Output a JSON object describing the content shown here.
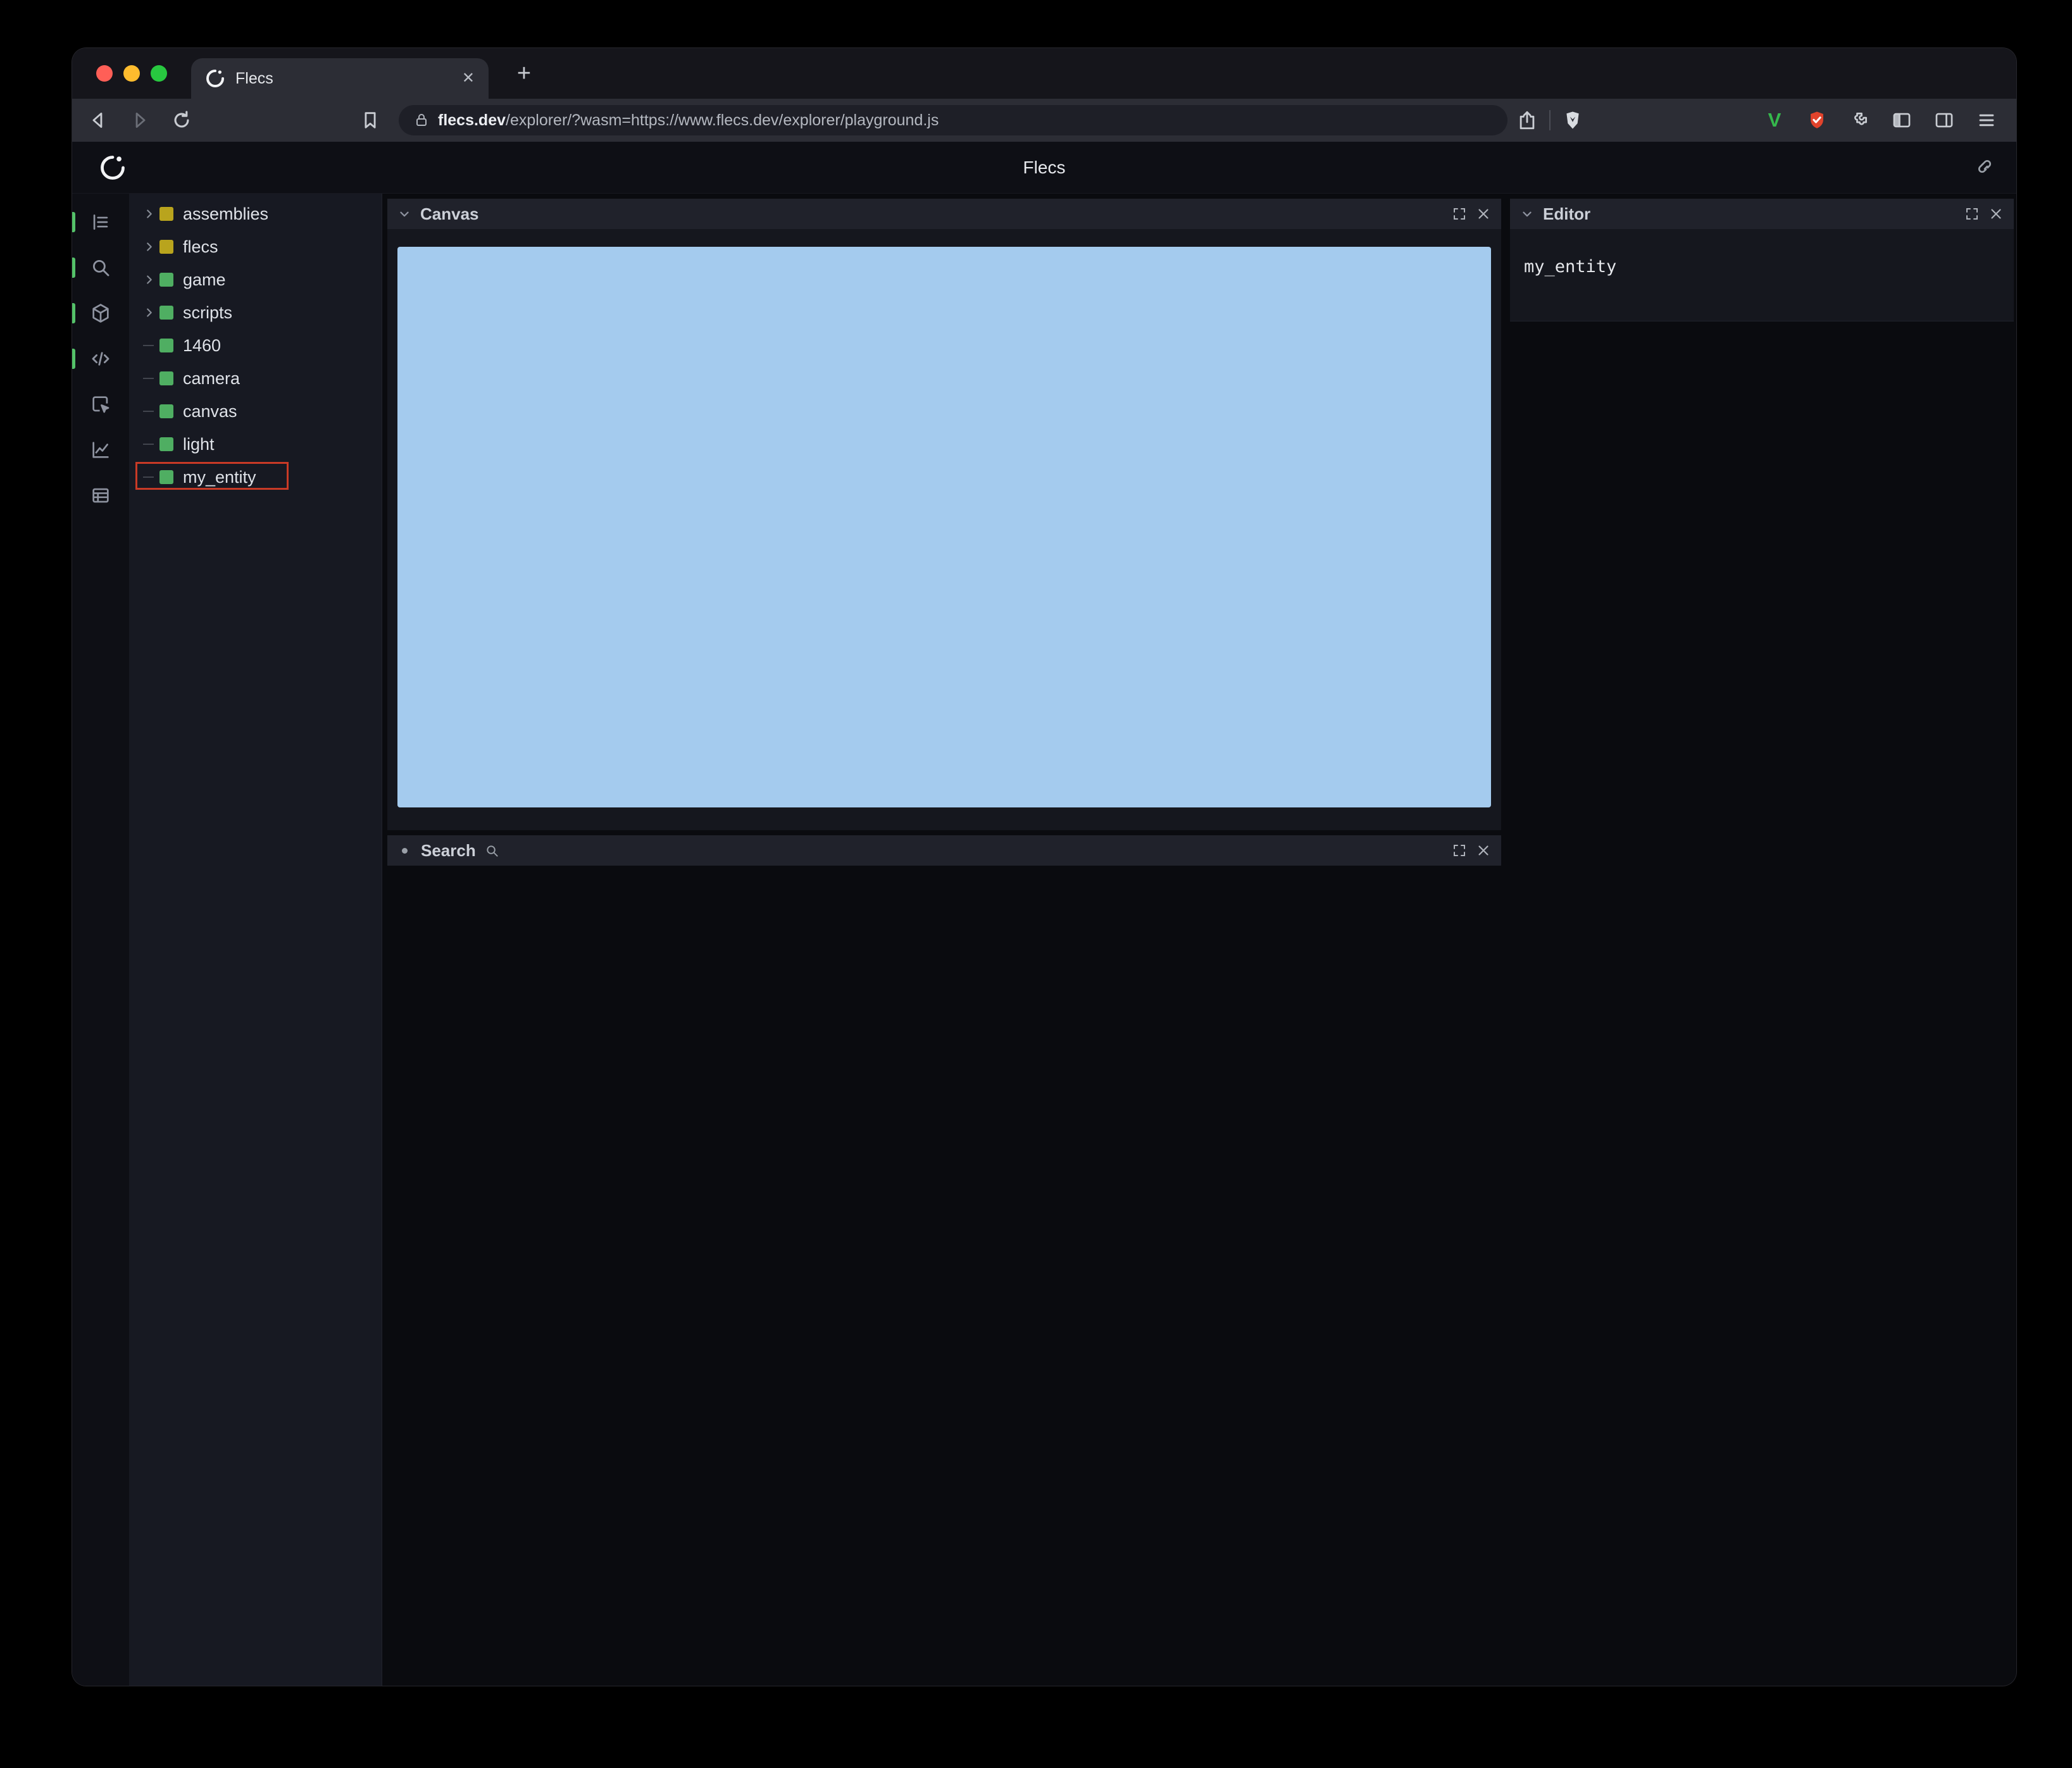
{
  "browser": {
    "tab": {
      "title": "Flecs"
    },
    "new_tab_glyph": "+",
    "close_tab_glyph": "✕",
    "url": {
      "domain": "flecs.dev",
      "path": "/explorer/?wasm=https://www.flecs.dev/explorer/playground.js"
    },
    "extensions": {
      "v_label": "V"
    }
  },
  "app": {
    "header": {
      "title": "Flecs"
    },
    "sidebar_icons": [
      "entity-tree",
      "search",
      "cube",
      "code",
      "inspect",
      "stats",
      "table"
    ],
    "tree": {
      "items": [
        {
          "label": "assemblies",
          "color": "#b9a41d",
          "expandable": true,
          "highlighted": false
        },
        {
          "label": "flecs",
          "color": "#b9a41d",
          "expandable": true,
          "highlighted": false
        },
        {
          "label": "game",
          "color": "#4fae62",
          "expandable": true,
          "highlighted": false
        },
        {
          "label": "scripts",
          "color": "#4fae62",
          "expandable": true,
          "highlighted": false
        },
        {
          "label": "1460",
          "color": "#4fae62",
          "expandable": false,
          "highlighted": false
        },
        {
          "label": "camera",
          "color": "#4fae62",
          "expandable": false,
          "highlighted": false
        },
        {
          "label": "canvas",
          "color": "#4fae62",
          "expandable": false,
          "highlighted": false
        },
        {
          "label": "light",
          "color": "#4fae62",
          "expandable": false,
          "highlighted": false
        },
        {
          "label": "my_entity",
          "color": "#4fae62",
          "expandable": false,
          "highlighted": true
        }
      ]
    },
    "panels": {
      "canvas": {
        "title": "Canvas"
      },
      "search": {
        "title": "Search"
      },
      "editor": {
        "title": "Editor",
        "content": "my_entity"
      }
    },
    "colors": {
      "canvas_blue": "#a4cbee",
      "highlight_red": "#c93a26",
      "accent_green": "#54c269",
      "square_yellow": "#b9a41d",
      "square_green": "#4fae62"
    }
  }
}
